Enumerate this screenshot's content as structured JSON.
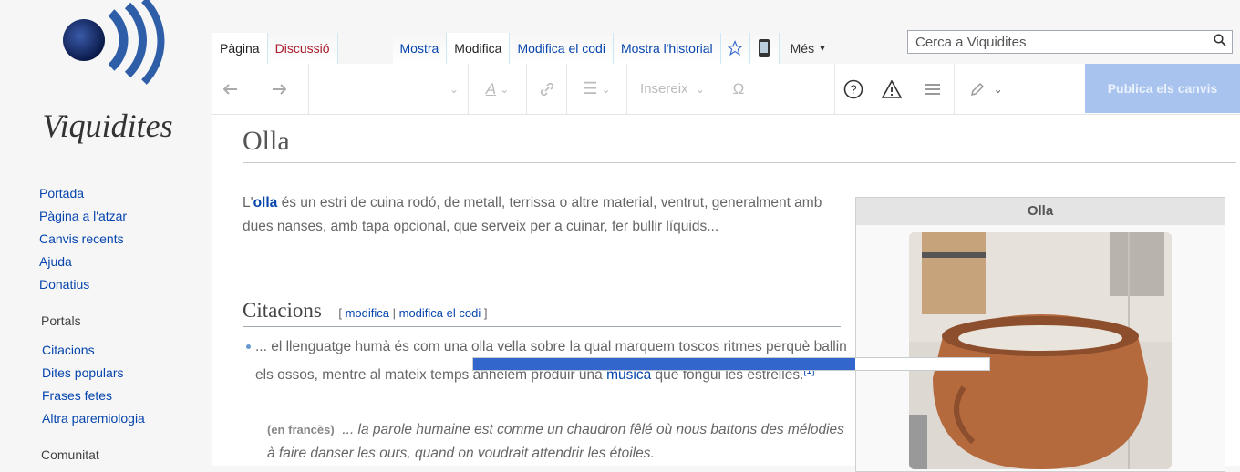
{
  "site": {
    "logo_text": "Viquidites"
  },
  "tabs": {
    "page": "Pàgina",
    "discussion": "Discussió",
    "view": "Mostra",
    "edit": "Modifica",
    "edit_source": "Modifica el codi",
    "history": "Mostra l'historial",
    "more": "Més"
  },
  "search": {
    "placeholder": "Cerca a Viquidites"
  },
  "toolbar": {
    "insert": "Insereix",
    "publish": "Publica els canvis"
  },
  "sidebar": {
    "nav": [
      "Portada",
      "Pàgina a l'atzar",
      "Canvis recents",
      "Ajuda",
      "Donatius"
    ],
    "portals_heading": "Portals",
    "portals": [
      "Citacions",
      "Dites populars",
      "Frases fetes",
      "Altra paremiologia"
    ],
    "community_heading": "Comunitat"
  },
  "article": {
    "title": "Olla",
    "intro_prefix": "L'",
    "intro_bold": "olla",
    "intro_rest": " és un estri de cuina rodó, de metall, terrissa o altre material, ventrut, generalment amb dues nanses, amb tapa opcional, que serveix per a cuinar, fer bullir líquids...",
    "section_title": "Citacions",
    "edit_open": "[ ",
    "edit_link": "modifica",
    "edit_sep": " | ",
    "edit_source_link": "modifica el codi",
    "edit_close": " ]",
    "quote_text": "... el llenguatge humà és com una olla vella sobre la qual marquem toscos ritmes perquè ballin els ossos, mentre al mateix temps anhelem produir una ",
    "quote_link": "música",
    "quote_end": " que fongui les estrelles.",
    "ref": "[1]",
    "trans_lang": "(en francès)",
    "trans_text": "... la parole humaine est comme un chaudron fêlé où nous battons des mélodies à faire danser les ours, quand on voudrait attendrir les étoiles."
  },
  "infobox": {
    "title": "Olla"
  },
  "progress": {
    "value": 0.74
  },
  "colors": {
    "link": "#0645ad",
    "accent": "#3366cc",
    "publish": "#a8c4ee"
  }
}
